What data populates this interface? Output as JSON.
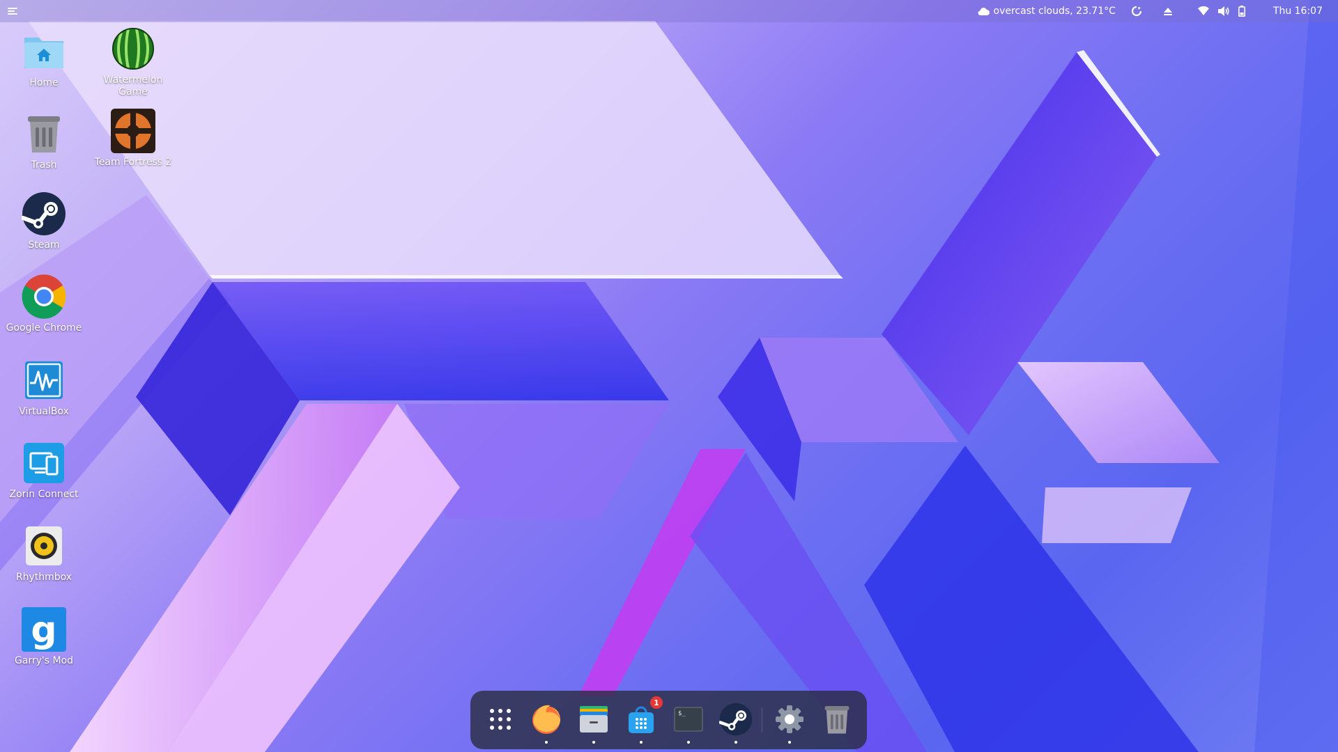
{
  "topbar": {
    "weather": "overcast clouds, 23.71°C",
    "clock": "Thu 16:07"
  },
  "desktop": {
    "icons": [
      {
        "label": "Home",
        "icon": "home-folder-icon"
      },
      {
        "label": "Watermelon Game",
        "icon": "watermelon-icon"
      },
      {
        "label": "Trash",
        "icon": "trash-icon"
      },
      {
        "label": "Team Fortress 2",
        "icon": "team-fortress-icon"
      },
      {
        "label": "Steam",
        "icon": "steam-icon"
      },
      {
        "label": "Google Chrome",
        "icon": "chrome-icon"
      },
      {
        "label": "VirtualBox",
        "icon": "virtualbox-icon"
      },
      {
        "label": "Zorin Connect",
        "icon": "zorin-connect-icon"
      },
      {
        "label": "Rhythmbox",
        "icon": "rhythmbox-icon"
      },
      {
        "label": "Garry's Mod",
        "icon": "garrys-mod-icon"
      }
    ]
  },
  "dock": {
    "items": [
      {
        "icon": "app-grid-icon",
        "running": false
      },
      {
        "icon": "firefox-icon",
        "running": true
      },
      {
        "icon": "files-icon",
        "running": true
      },
      {
        "icon": "software-store-icon",
        "running": true,
        "badge": "1"
      },
      {
        "icon": "terminal-icon",
        "running": true
      },
      {
        "icon": "steam-icon",
        "running": true
      },
      {
        "icon": "settings-icon",
        "running": true
      },
      {
        "icon": "trash-icon",
        "running": false
      }
    ]
  },
  "colors": {
    "accent": "#1e88e5",
    "badge": "#e53935",
    "dock_bg": "#282c3c"
  }
}
